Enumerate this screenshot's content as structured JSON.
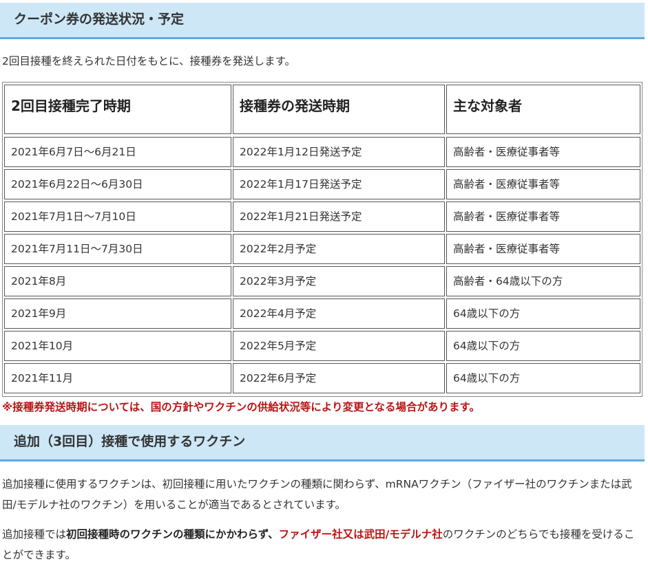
{
  "section1": {
    "title": "クーポン券の発送状況・予定",
    "intro": "2回目接種を終えられた日付をもとに、接種券を発送します。"
  },
  "table": {
    "headers": [
      "2回目接種完了時期",
      "接種券の発送時期",
      "主な対象者"
    ],
    "rows": [
      [
        "2021年6月7日～6月21日",
        "2022年1月12日発送予定",
        "高齢者・医療従事者等"
      ],
      [
        "2021年6月22日～6月30日",
        "2022年1月17日発送予定",
        "高齢者・医療従事者等"
      ],
      [
        "2021年7月1日～7月10日",
        "2022年1月21日発送予定",
        "高齢者・医療従事者等"
      ],
      [
        "2021年7月11日～7月30日",
        "2022年2月予定",
        "高齢者・医療従事者等"
      ],
      [
        "2021年8月",
        "2022年3月予定",
        "高齢者・64歳以下の方"
      ],
      [
        "2021年9月",
        "2022年4月予定",
        "64歳以下の方"
      ],
      [
        "2021年10月",
        "2022年5月予定",
        "64歳以下の方"
      ],
      [
        "2021年11月",
        "2022年6月予定",
        "64歳以下の方"
      ]
    ]
  },
  "note": "※接種券発送時期については、国の方針やワクチンの供給状況等により変更となる場合があります。",
  "section2": {
    "title": "追加（3回目）接種で使用するワクチン",
    "p1": "追加接種に使用するワクチンは、初回接種に用いたワクチンの種類に関わらず、mRNAワクチン（ファイザー社のワクチンまたは武田/モデルナ社のワクチン）を用いることが適当であるとされています。",
    "p2_a": "追加接種では",
    "p2_b": "初回接種時のワクチンの種類にかかわらず、",
    "p2_c": "ファイザー社又は武田/モデルナ社",
    "p2_d": "のワクチンのどちらでも接種を受けることができます。"
  },
  "colors": {
    "heading_bg": "#cde7f7",
    "heading_border": "#5aa9e6",
    "emphasis_red": "#b81414"
  }
}
